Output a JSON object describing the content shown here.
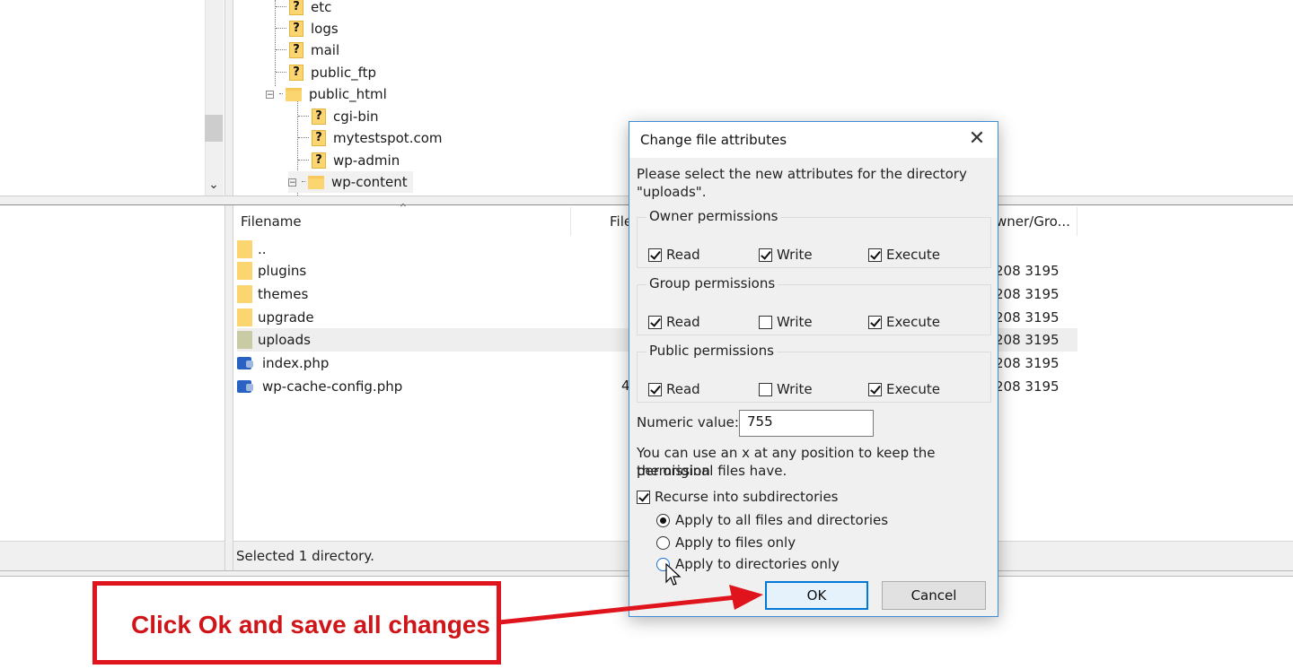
{
  "tree": {
    "items": [
      {
        "label": "etc",
        "icon": "question-folder-icon"
      },
      {
        "label": "logs",
        "icon": "question-folder-icon"
      },
      {
        "label": "mail",
        "icon": "question-folder-icon"
      },
      {
        "label": "public_ftp",
        "icon": "question-folder-icon"
      },
      {
        "label": "public_html",
        "icon": "folder-icon"
      },
      {
        "label": "cgi-bin",
        "icon": "question-folder-icon"
      },
      {
        "label": "mytestspot.com",
        "icon": "question-folder-icon"
      },
      {
        "label": "wp-admin",
        "icon": "question-folder-icon"
      },
      {
        "label": "wp-content",
        "icon": "folder-icon"
      }
    ]
  },
  "file_list": {
    "columns": {
      "filename": "Filename",
      "filesize": "File",
      "owner": "wner/Gro..."
    },
    "rows": [
      {
        "name": "..",
        "owner": ""
      },
      {
        "name": "plugins",
        "owner": "208 3195"
      },
      {
        "name": "themes",
        "owner": "208 3195"
      },
      {
        "name": "upgrade",
        "owner": "208 3195"
      },
      {
        "name": "uploads",
        "owner": "208 3195"
      },
      {
        "name": "index.php",
        "owner": "208 3195"
      },
      {
        "name": "wp-cache-config.php",
        "size_fragment": "4",
        "owner": "208 3195"
      }
    ],
    "status": "Selected 1 directory."
  },
  "dialog": {
    "title": "Change file attributes",
    "intro_line1": "Please select the new attributes for the directory",
    "intro_line2": "\"uploads\".",
    "groups": [
      {
        "legend": "Owner permissions",
        "read": true,
        "write": true,
        "execute": true
      },
      {
        "legend": "Group permissions",
        "read": true,
        "write": false,
        "execute": true
      },
      {
        "legend": "Public permissions",
        "read": true,
        "write": false,
        "execute": true
      }
    ],
    "labels": {
      "read": "Read",
      "write": "Write",
      "execute": "Execute"
    },
    "numeric_label": "Numeric value:",
    "numeric_value": "755",
    "hint_line1": "You can use an x at any position to keep the permission",
    "hint_line2": "the original files have.",
    "recurse_label": "Recurse into subdirectories",
    "recurse_checked": true,
    "radios": [
      {
        "label": "Apply to all files and directories",
        "selected": true
      },
      {
        "label": "Apply to files only",
        "selected": false
      },
      {
        "label": "Apply to directories only",
        "selected": false
      }
    ],
    "ok_label": "OK",
    "cancel_label": "Cancel"
  },
  "annotation": {
    "text": "Click Ok and save all changes",
    "color": "#e0141c"
  }
}
